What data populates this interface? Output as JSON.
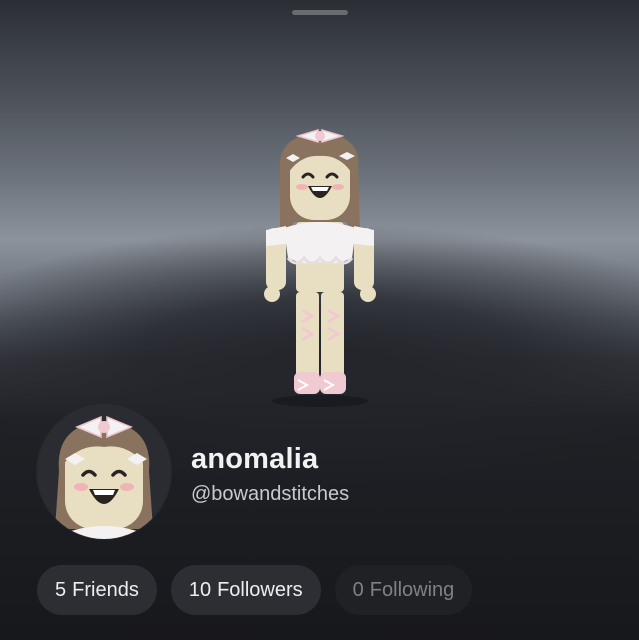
{
  "sheet": {
    "drag_handle": "drag-handle"
  },
  "avatar": {
    "description_icon": "avatar-3d-icon"
  },
  "profile": {
    "display_name": "anomalia",
    "username": "@bowandstitches",
    "photo_icon": "profile-headshot-icon"
  },
  "stats": [
    {
      "count": "5",
      "label": "Friends"
    },
    {
      "count": "10",
      "label": "Followers"
    },
    {
      "count": "0",
      "label": "Following"
    }
  ],
  "colors": {
    "skin": "#e8dfc3",
    "hair": "#8a735e",
    "outfit_white": "#f4f1f2",
    "outfit_pink": "#f1c9d1"
  }
}
